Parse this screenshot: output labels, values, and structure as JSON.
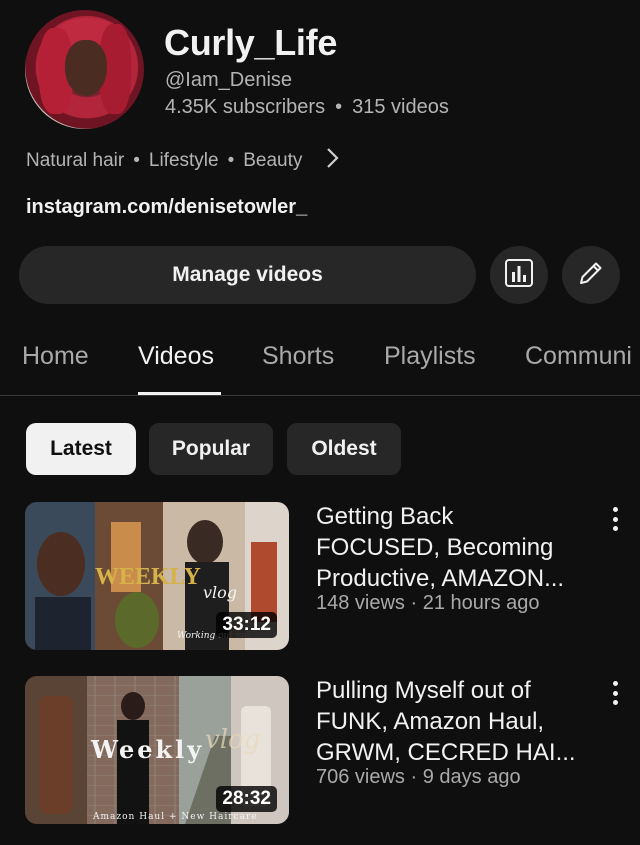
{
  "channel": {
    "name": "Curly_Life",
    "handle": "@Iam_Denise",
    "subscribers": "4.35K subscribers",
    "separator": "•",
    "videos_count": "315 videos",
    "tags": [
      "Natural hair",
      "Lifestyle",
      "Beauty"
    ],
    "link": "instagram.com/denisetowler_"
  },
  "actions": {
    "manage_label": "Manage videos",
    "analytics_icon": "analytics-icon",
    "edit_icon": "pencil-icon"
  },
  "tabs": [
    "Home",
    "Videos",
    "Shorts",
    "Playlists",
    "Communi"
  ],
  "active_tab": "Videos",
  "filters": [
    "Latest",
    "Popular",
    "Oldest"
  ],
  "active_filter": "Latest",
  "videos": [
    {
      "title_lines": [
        "Getting Back",
        "FOCUSED, Becoming",
        "Productive, AMAZON..."
      ],
      "views": "148 views",
      "age": "21 hours ago",
      "meta_sep": "·",
      "duration": "33:12",
      "thumb_text": "WEEKLY",
      "thumb_sub": "vlog",
      "thumb_caption": "Working out me"
    },
    {
      "title_lines": [
        "Pulling Myself out of",
        "FUNK, Amazon Haul,",
        "GRWM, CECRED HAI..."
      ],
      "views": "706 views",
      "age": "9 days ago",
      "meta_sep": "·",
      "duration": "28:32",
      "thumb_text": "Weekly",
      "thumb_sub": "vlog",
      "thumb_caption": "Amazon Haul + New Haircare"
    }
  ],
  "colors": {
    "background": "#0f0f0f",
    "surface": "#272727",
    "text": "#f1f1f1",
    "secondary": "#a9a9a9"
  }
}
